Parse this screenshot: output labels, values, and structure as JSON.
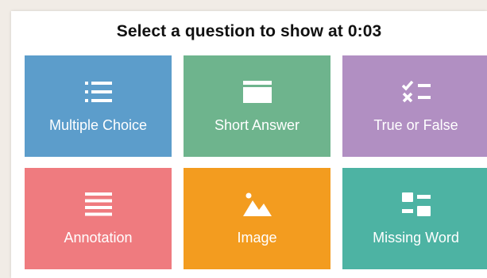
{
  "title": "Select a question to show at 0:03",
  "tiles": [
    {
      "label": "Multiple Choice",
      "icon": "list-bullet-icon",
      "color": "#5c9dcb"
    },
    {
      "label": "Short Answer",
      "icon": "text-box-icon",
      "color": "#6eb48d"
    },
    {
      "label": "True or False",
      "icon": "check-x-icon",
      "color": "#b18fc2"
    },
    {
      "label": "Annotation",
      "icon": "lines-icon",
      "color": "#ef7b7f"
    },
    {
      "label": "Image",
      "icon": "mountain-image-icon",
      "color": "#f39c1f"
    },
    {
      "label": "Missing Word",
      "icon": "fill-blank-icon",
      "color": "#4db3a3"
    }
  ]
}
